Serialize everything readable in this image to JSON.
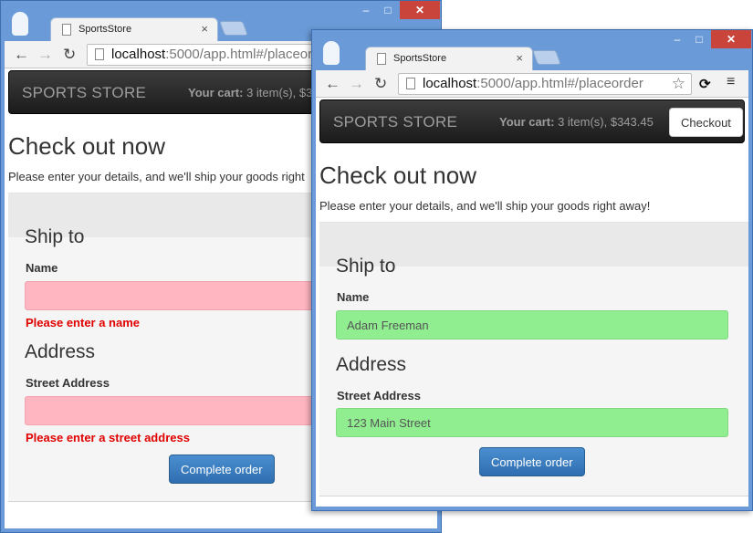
{
  "browser": {
    "tab_title": "SportsStore",
    "tab_close": "×",
    "url_host": "localhost",
    "url_path_back": ":5000/app.html#/placeord",
    "url_path_front": ":5000/app.html#/placeorder",
    "min_glyph": "–",
    "max_glyph": "□",
    "close_glyph": "✕",
    "back_glyph": "←",
    "forward_glyph": "→",
    "reload_glyph": "↻",
    "star_glyph": "☆",
    "ext_glyph": "⟳",
    "menu_glyph": "≡"
  },
  "navbar": {
    "brand": "SPORTS STORE",
    "cart_label": "Your cart:",
    "cart_summary_back": "3 item(s), $3",
    "cart_summary_front": "3 item(s), $343.45",
    "checkout_label": "Checkout"
  },
  "page": {
    "title": "Check out now",
    "intro_back": "Please enter your details, and we'll ship your goods right",
    "intro_front": "Please enter your details, and we'll ship your goods right away!"
  },
  "form": {
    "ship_to_heading": "Ship to",
    "name_label": "Name",
    "address_heading": "Address",
    "street_label": "Street Address",
    "submit_label": "Complete order"
  },
  "back_window": {
    "name_value": "",
    "street_value": "",
    "name_error": "Please enter a name",
    "street_error": "Please enter a street address"
  },
  "front_window": {
    "name_value": "Adam Freeman",
    "street_value": "123 Main Street"
  },
  "colors": {
    "invalid_field": "#ffb6c1",
    "valid_field": "#90ee90",
    "error_text": "#e00000",
    "primary_button": "#337ab7",
    "window_frame": "#6a9bd8",
    "close_button": "#c9453b"
  }
}
